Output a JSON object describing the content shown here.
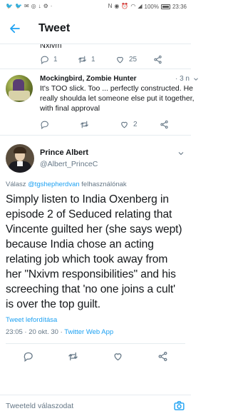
{
  "status_bar": {
    "battery_percent": "100%",
    "time": "23:36"
  },
  "header": {
    "title": "Tweet"
  },
  "prev_tweet": {
    "clipped_text": "Nxivm",
    "reply_count": "1",
    "retweet_count": "1",
    "like_count": "25"
  },
  "reply_tweet": {
    "display_name": "Mockingbird, Zombie Hunter",
    "timestamp": "· 3 n",
    "text": "It's TOO slick. Too ... perfectly constructed. He really shoulda let someone else put it together, with final approval",
    "like_count": "2"
  },
  "main_tweet": {
    "display_name": "Prince Albert",
    "handle": "@Albert_PrinceC",
    "reply_prefix": "Válasz ",
    "reply_mention": "@tgshepherdvan",
    "reply_suffix": " felhasználónak",
    "text": "Simply listen to India Oxenberg in episode 2 of Seduced relating that Vincente guilted her (she says wept) because India chose an acting relating job which took away from her \"Nxivm responsibilities\" and his screeching that 'no one joins a cult' is over the top guilt.",
    "translate_label": "Tweet lefordítása",
    "datetime": "23:05 · 20 okt. 30 · ",
    "source": "Twitter Web App"
  },
  "compose": {
    "placeholder": "Tweeteld válaszodat"
  },
  "colors": {
    "accent": "#1da1f2",
    "secondary_text": "#657786",
    "primary_text": "#14171a"
  }
}
